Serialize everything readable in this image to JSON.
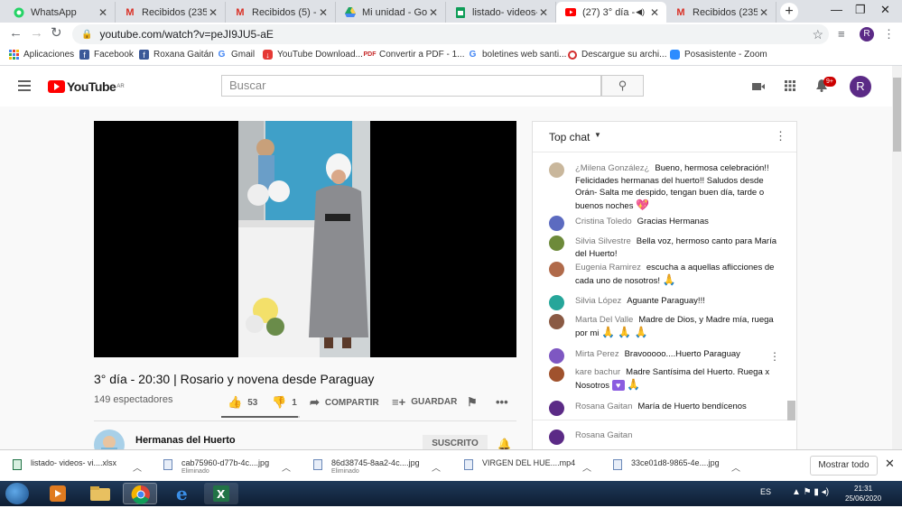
{
  "browser": {
    "tabs": [
      {
        "label": "WhatsApp",
        "icon": "whatsapp-icon",
        "active": false
      },
      {
        "label": "Recibidos (235) - ro",
        "icon": "gmail-icon",
        "active": false
      },
      {
        "label": "Recibidos (5) - ega",
        "icon": "gmail-icon",
        "active": false
      },
      {
        "label": "Mi unidad - Google",
        "icon": "drive-icon",
        "active": false
      },
      {
        "label": "listado- videos- vig",
        "icon": "sheets-icon",
        "active": false
      },
      {
        "label": "(27) 3° día - 20",
        "icon": "youtube-icon",
        "active": true
      },
      {
        "label": "Recibidos (235) - ro",
        "icon": "gmail-icon",
        "active": false
      }
    ],
    "url": "youtube.com/watch?v=peJI9JU5-aE",
    "profile_initial": "R",
    "bookmarks": [
      {
        "label": "Aplicaciones",
        "icon": "apps-grid-icon"
      },
      {
        "label": "Facebook",
        "icon": "facebook-icon"
      },
      {
        "label": "Roxana Gaitán",
        "icon": "facebook-icon"
      },
      {
        "label": "Gmail",
        "icon": "google-icon"
      },
      {
        "label": "YouTube Download...",
        "icon": "download-app-icon"
      },
      {
        "label": "Convertir a PDF - 1...",
        "icon": "pdf-icon"
      },
      {
        "label": "boletines web santi...",
        "icon": "google-icon"
      },
      {
        "label": "Descargue su archi...",
        "icon": "blocked-icon"
      },
      {
        "label": "Posasistente - Zoom",
        "icon": "zoom-icon"
      }
    ]
  },
  "youtube": {
    "logo_text": "YouTube",
    "logo_region": "AR",
    "search_placeholder": "Buscar",
    "notifications_badge": "9+",
    "avatar_initial": "R",
    "video": {
      "title": "3° día - 20:30 | Rosario y novena desde Paraguay",
      "views": "149 espectadores",
      "likes": "53",
      "dislikes": "1",
      "share_label": "COMPARTIR",
      "save_label": "GUARDAR",
      "like_ratio": 0.98
    },
    "channel": {
      "name": "Hermanas del Huerto",
      "subscribe_label": "SUSCRITO"
    },
    "chat": {
      "header": "Top chat",
      "messages": [
        {
          "author": "¿Milena González¿",
          "text": "Bueno, hermosa celebración!! Felicidades hermanas del huerto!! Saludos desde Orán- Salta me despido, tengan buen día, tarde o buenos noches",
          "emoji": "heart",
          "avatar_color": "#c9b79c"
        },
        {
          "author": "Cristina Toledo",
          "text": "Gracias Hermanas",
          "emoji": "",
          "avatar_color": "#5c6bc0"
        },
        {
          "author": "Silvia Silvestre",
          "text": "Bella voz, hermoso canto para María del Huerto!",
          "emoji": "",
          "avatar_color": "#6d8a3a"
        },
        {
          "author": "Eugenia Ramirez",
          "text": "escucha a aquellas aflicciones de cada uno de nosotros!",
          "emoji": "pray1",
          "avatar_color": "#b06a4a"
        },
        {
          "author": "Silvia López",
          "text": "Aguante Paraguay!!!",
          "emoji": "",
          "avatar_color": "#26a69a"
        },
        {
          "author": "Marta Del Valle",
          "text": "Madre de Dios, y Madre mía, ruega por mi",
          "emoji": "pray3",
          "avatar_color": "#8a5a44"
        },
        {
          "author": "Mirta Perez",
          "text": "Bravooooo....Huerto Paraguay",
          "emoji": "",
          "avatar_color": "#7e57c2"
        },
        {
          "author": "kare bachur",
          "text": "Madre Santísima del Huerto. Ruega x Nosotros",
          "emoji": "purpleheart-pray",
          "avatar_color": "#a0522d"
        },
        {
          "author": "Rosana Gaitan",
          "text": "María de Huerto bendícenos",
          "emoji": "",
          "avatar_color": "#5b2a86"
        },
        {
          "author": "Rosana Gaitan",
          "text": "",
          "emoji": "",
          "avatar_color": "#5b2a86"
        }
      ]
    }
  },
  "downloads": {
    "items": [
      {
        "name": "listado- videos- vi....xlsx",
        "status": "",
        "icon": "excel-file-icon"
      },
      {
        "name": "cab75960-d77b-4c....jpg",
        "status": "Eliminado",
        "icon": "image-file-icon"
      },
      {
        "name": "86d38745-8aa2-4c....jpg",
        "status": "Eliminado",
        "icon": "image-file-icon"
      },
      {
        "name": "VIRGEN DEL HUE....mp4",
        "status": "",
        "icon": "video-file-icon"
      },
      {
        "name": "33ce01d8-9865-4e....jpg",
        "status": "",
        "icon": "image-file-icon"
      }
    ],
    "show_all_label": "Mostrar todo"
  },
  "taskbar": {
    "language": "ES",
    "time": "21:31",
    "date": "25/06/2020"
  },
  "colors": {
    "youtube_red": "#ff0000",
    "chrome_tabstrip": "#dee1e6",
    "profile_purple": "#5b2a86"
  }
}
